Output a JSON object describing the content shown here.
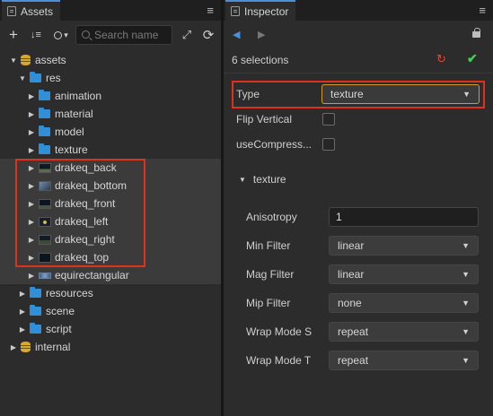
{
  "assets_panel": {
    "tab_label": "Assets",
    "menu_glyph": "≡",
    "toolbar": {
      "add_glyph": "+",
      "sort_glyph": "↓≡",
      "search_type_glyph": "▾",
      "search_placeholder": "Search name",
      "collapse_glyph": "⤢",
      "refresh_glyph": "⟳"
    },
    "tree": [
      {
        "label": "assets",
        "depth": 0,
        "icon": "database-icon",
        "expanded": true
      },
      {
        "label": "res",
        "depth": 1,
        "icon": "folder-icon",
        "expanded": true
      },
      {
        "label": "animation",
        "depth": 2,
        "icon": "folder-icon",
        "expanded": false
      },
      {
        "label": "material",
        "depth": 2,
        "icon": "folder-icon",
        "expanded": false
      },
      {
        "label": "model",
        "depth": 2,
        "icon": "folder-icon",
        "expanded": false
      },
      {
        "label": "texture",
        "depth": 2,
        "icon": "folder-icon",
        "expanded": false
      },
      {
        "label": "drakeq_back",
        "depth": 2,
        "icon": "image-thumb-icon",
        "expanded": false,
        "selected": true
      },
      {
        "label": "drakeq_bottom",
        "depth": 2,
        "icon": "image-thumb-icon",
        "expanded": false,
        "selected": true
      },
      {
        "label": "drakeq_front",
        "depth": 2,
        "icon": "image-thumb-icon",
        "expanded": false,
        "selected": true
      },
      {
        "label": "drakeq_left",
        "depth": 2,
        "icon": "image-thumb-icon",
        "expanded": false,
        "selected": true
      },
      {
        "label": "drakeq_right",
        "depth": 2,
        "icon": "image-thumb-icon",
        "expanded": false,
        "selected": true
      },
      {
        "label": "drakeq_top",
        "depth": 2,
        "icon": "image-thumb-icon",
        "expanded": false,
        "selected": true
      },
      {
        "label": "equirectangular",
        "depth": 2,
        "icon": "image-thumb-icon",
        "expanded": false,
        "selected": true
      },
      {
        "label": "resources",
        "depth": 1,
        "icon": "folder-icon",
        "expanded": false
      },
      {
        "label": "scene",
        "depth": 1,
        "icon": "folder-icon",
        "expanded": false
      },
      {
        "label": "script",
        "depth": 1,
        "icon": "folder-icon",
        "expanded": false
      },
      {
        "label": "internal",
        "depth": 0,
        "icon": "database-icon",
        "expanded": false
      }
    ]
  },
  "inspector_panel": {
    "tab_label": "Inspector",
    "menu_glyph": "≡",
    "back_glyph": "◀",
    "forward_glyph": "▶",
    "selection_label": "6 selections",
    "revert_glyph": "↻",
    "apply_glyph": "✔",
    "type": {
      "label": "Type",
      "value": "texture"
    },
    "flip_vertical": {
      "label": "Flip Vertical",
      "checked": false
    },
    "use_compress": {
      "label": "useCompress...",
      "checked": false
    },
    "texture_section": {
      "title": "texture",
      "anisotropy": {
        "label": "Anisotropy",
        "value": "1"
      },
      "min_filter": {
        "label": "Min Filter",
        "value": "linear"
      },
      "mag_filter": {
        "label": "Mag Filter",
        "value": "linear"
      },
      "mip_filter": {
        "label": "Mip Filter",
        "value": "none"
      },
      "wrap_mode_s": {
        "label": "Wrap Mode S",
        "value": "repeat"
      },
      "wrap_mode_t": {
        "label": "Wrap Mode T",
        "value": "repeat"
      }
    }
  },
  "colors": {
    "accent_blue": "#4a90d9",
    "folder": "#2f8fd8",
    "database": "#d8a92a",
    "highlight_box": "#e0301e",
    "apply": "#3bd44a",
    "revert": "#e04a3a"
  }
}
